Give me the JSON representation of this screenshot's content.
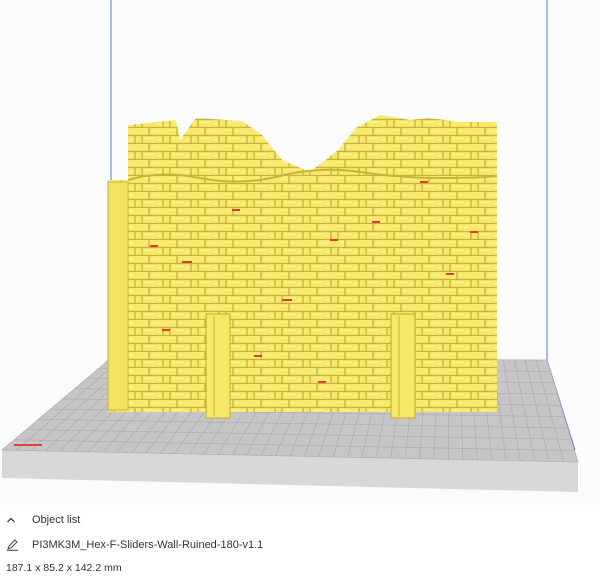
{
  "viewport": {
    "name": "3d-build-plate-view",
    "colors": {
      "model": "#f7ea6a",
      "model_shadow": "#d8c54a",
      "overhang": "#e53935",
      "plate": "#c6c6c6",
      "grid": "#aaaaaa",
      "build_volume": "#4f7bd8",
      "axis_x": "#e04040"
    }
  },
  "object_list": {
    "header_label": "Object list",
    "header_icon": "chevron-up-icon",
    "edit_icon": "pencil-icon",
    "object_name": "PI3MK3M_Hex-F-Sliders-Wall-Ruined-180-v1.1",
    "dimensions": "187.1 x 85.2 x 142.2 mm"
  }
}
